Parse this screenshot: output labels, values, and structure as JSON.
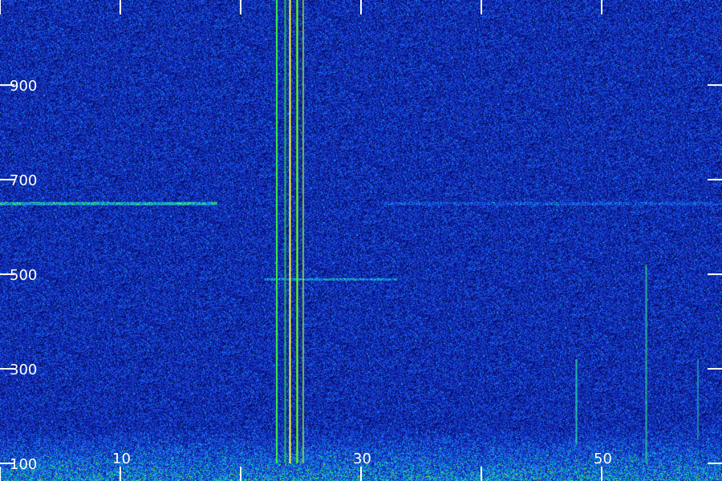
{
  "chart_data": {
    "type": "heatmap",
    "title": "",
    "xlabel": "",
    "ylabel": "",
    "x_ticks": [
      0,
      10,
      20,
      30,
      40,
      50
    ],
    "x_tick_labels": [
      "10",
      "30",
      "50"
    ],
    "x_tick_label_values": [
      10,
      30,
      50
    ],
    "y_ticks": [
      100,
      300,
      500,
      700,
      900
    ],
    "y_tick_labels": [
      "100",
      "300",
      "500",
      "700",
      "900"
    ],
    "xlim": [
      0,
      60
    ],
    "ylim": [
      100,
      1080
    ],
    "colormap": [
      "#00001e",
      "#0a148c",
      "#1432c8",
      "#1e78ff",
      "#00dca0",
      "#7aff20",
      "#ffc000",
      "#ff2a00"
    ],
    "background_color": "#0a1678",
    "vertical_lines": [
      {
        "x": 23.0,
        "y_min": 100,
        "y_max": 1080,
        "color": "#3cff3c",
        "intensity": 0.85
      },
      {
        "x": 23.7,
        "y_min": 100,
        "y_max": 1080,
        "color": "#32dc32",
        "intensity": 0.7
      },
      {
        "x": 24.1,
        "y_min": 100,
        "y_max": 1080,
        "color": "#ffff28",
        "intensity": 0.9
      },
      {
        "x": 24.7,
        "y_min": 100,
        "y_max": 1080,
        "color": "#64ff00",
        "intensity": 1.0
      },
      {
        "x": 25.2,
        "y_min": 100,
        "y_max": 1080,
        "color": "#b4ff00",
        "intensity": 0.6
      },
      {
        "x": 47.9,
        "y_min": 140,
        "y_max": 320,
        "color": "#28e6aa",
        "intensity": 0.7
      },
      {
        "x": 53.7,
        "y_min": 100,
        "y_max": 520,
        "color": "#32e682",
        "intensity": 0.6
      },
      {
        "x": 58.0,
        "y_min": 150,
        "y_max": 320,
        "color": "#28c8aa",
        "intensity": 0.5
      }
    ],
    "horizontal_features": [
      {
        "y": 650,
        "x_min": 0,
        "x_max": 18,
        "intensity": 0.45
      },
      {
        "y": 490,
        "x_min": 22,
        "x_max": 33,
        "intensity": 0.35
      },
      {
        "y": 650,
        "x_min": 32,
        "x_max": 60,
        "intensity": 0.15
      }
    ],
    "noise_band": {
      "y_min": 100,
      "y_max": 175,
      "x_min": 0,
      "x_max": 60
    }
  }
}
